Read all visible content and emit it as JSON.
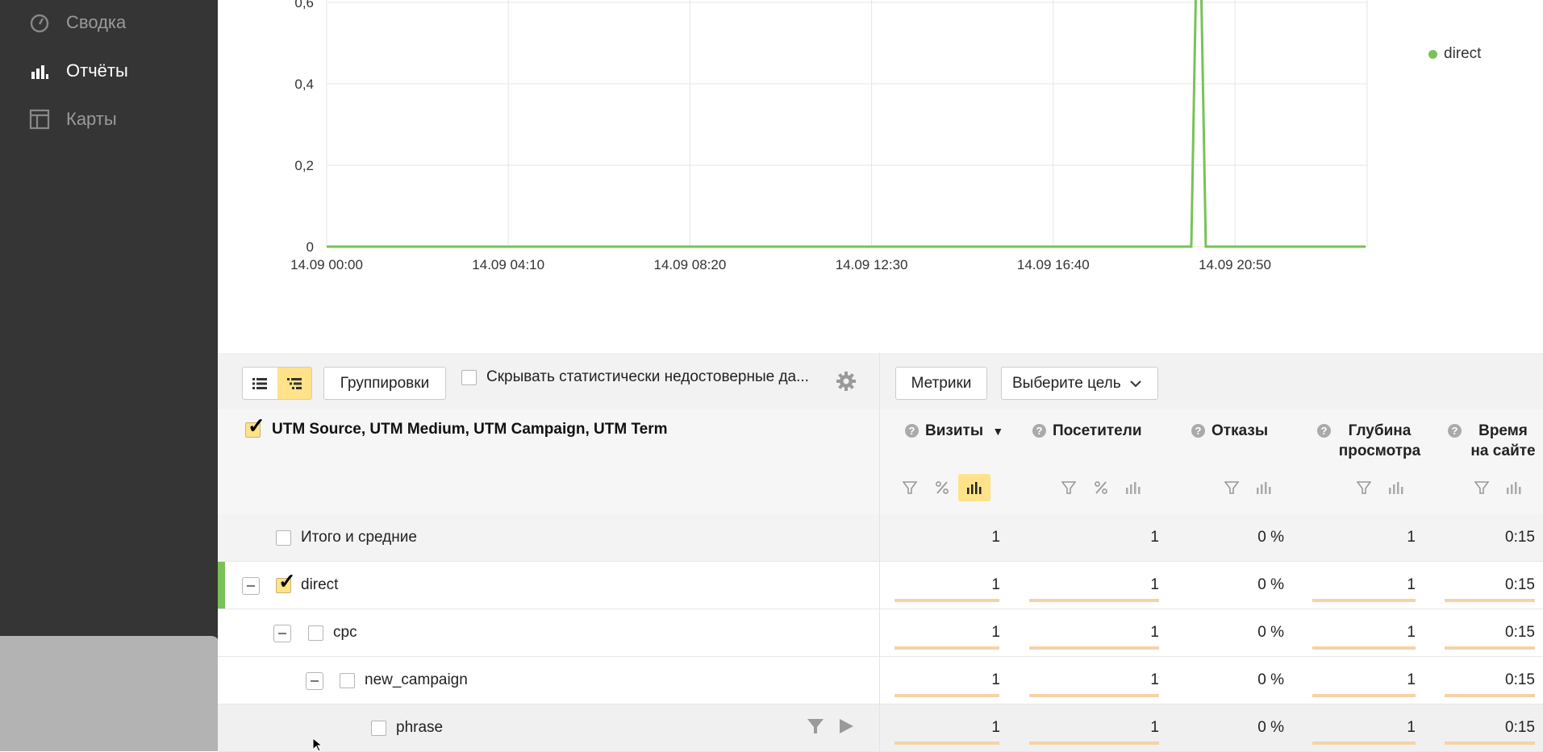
{
  "sidebar": {
    "items": [
      {
        "label": "Сводка",
        "icon": "dashboard-icon",
        "active": false
      },
      {
        "label": "Отчёты",
        "icon": "bar-chart-icon",
        "active": true
      },
      {
        "label": "Карты",
        "icon": "map-layout-icon",
        "active": false
      }
    ]
  },
  "chart_data": {
    "type": "line",
    "x": [
      "14.09 00:00",
      "14.09 04:10",
      "14.09 08:20",
      "14.09 12:30",
      "14.09 16:40",
      "14.09 20:50"
    ],
    "yticks": [
      "0",
      "0,2",
      "0,4",
      "0,6"
    ],
    "ylim": [
      0,
      0.6
    ],
    "series": [
      {
        "name": "direct",
        "color": "#78c257",
        "points": [
          [
            "14.09 00:00",
            0
          ],
          [
            "14.09 19:50",
            0
          ],
          [
            "14.09 20:00",
            1
          ],
          [
            "14.09 20:10",
            0
          ],
          [
            "14.09 23:50",
            0
          ]
        ]
      }
    ],
    "legend": "top-right",
    "grid": true
  },
  "toolbar": {
    "groupings_label": "Группировки",
    "hide_unreliable_label": "Скрывать статистически недостоверные да...",
    "metrics_label": "Метрики",
    "goal_select_label": "Выберите цель"
  },
  "table": {
    "dimension_title": "UTM Source, UTM Medium, UTM Campaign, UTM Term",
    "columns": [
      {
        "label": "Визиты",
        "sorted": true,
        "sort_indicator": "▼"
      },
      {
        "label": "Посетители"
      },
      {
        "label": "Отказы"
      },
      {
        "label": "Глубина просмотра"
      },
      {
        "label": "Время на сайте"
      }
    ],
    "rows": [
      {
        "label": "Итого и средние",
        "values": [
          "1",
          "1",
          "0 %",
          "1",
          "0:15"
        ]
      },
      {
        "label": "direct",
        "values": [
          "1",
          "1",
          "0 %",
          "1",
          "0:15"
        ]
      },
      {
        "label": "cpc",
        "values": [
          "1",
          "1",
          "0 %",
          "1",
          "0:15"
        ]
      },
      {
        "label": "new_campaign",
        "values": [
          "1",
          "1",
          "0 %",
          "1",
          "0:15"
        ]
      },
      {
        "label": "phrase",
        "values": [
          "1",
          "1",
          "0 %",
          "1",
          "0:15"
        ]
      }
    ]
  },
  "colors": {
    "sidebar_bg": "#353535",
    "accent_yellow": "#ffe28a",
    "series_green": "#78c257",
    "bar_orange": "#f4d3a8"
  }
}
